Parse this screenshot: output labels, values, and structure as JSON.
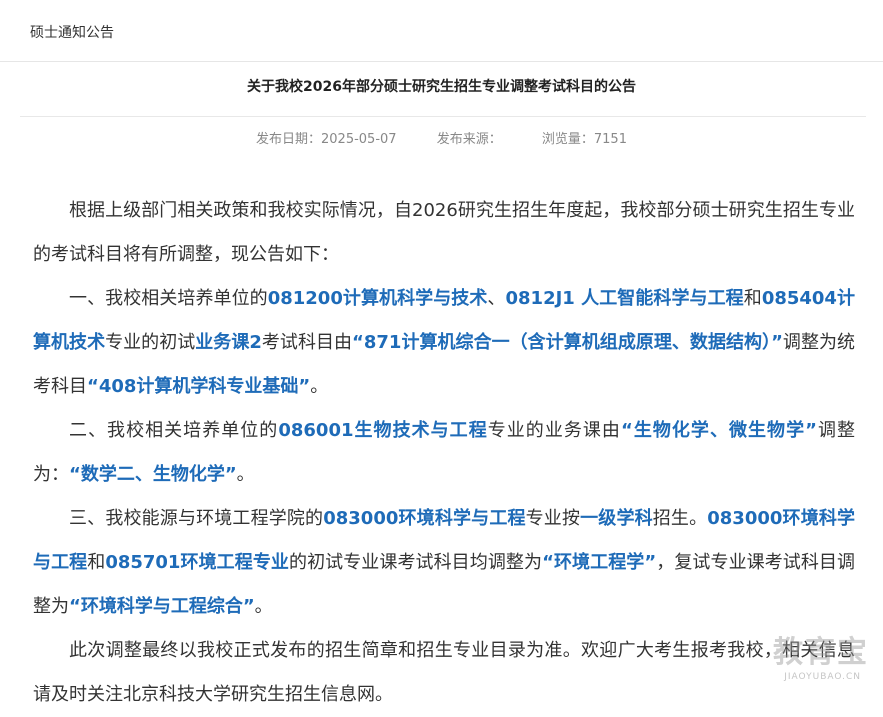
{
  "breadcrumb": "硕士通知公告",
  "article": {
    "title": "关于我校2026年部分硕士研究生招生专业调整考试科目的公告",
    "meta": {
      "date_label": "发布日期：",
      "date": "2025-05-07",
      "source_label": "发布来源：",
      "source": "",
      "views_label": "浏览量：",
      "views": "7151"
    },
    "paragraphs": [
      [
        {
          "text": "根据上级部门相关政策和我校实际情况，自2026研究生招生年度起，我校部分硕士研究生招生专业的考试科目将有所调整，现公告如下："
        }
      ],
      [
        {
          "text": "一、我校相关培养单位的"
        },
        {
          "text": "081200计算机科学与技术",
          "hl": true
        },
        {
          "text": "、"
        },
        {
          "text": "0812J1 人工智能科学与工程",
          "hl": true
        },
        {
          "text": "和"
        },
        {
          "text": "085404计算机技术",
          "hl": true
        },
        {
          "text": "专业的初试"
        },
        {
          "text": "业务课2",
          "hl": true
        },
        {
          "text": "考试科目由"
        },
        {
          "text": "“871计算机综合一（含计算机组成原理、数据结构）”",
          "hl": true
        },
        {
          "text": "调整为统考科目"
        },
        {
          "text": "“408计算机学科专业基础”",
          "hl": true
        },
        {
          "text": "。"
        }
      ],
      [
        {
          "text": "二、我校相关培养单位的"
        },
        {
          "text": "086001生物技术与工程",
          "hl": true
        },
        {
          "text": "专业的业务课由"
        },
        {
          "text": "“生物化学、微生物学”",
          "hl": true
        },
        {
          "text": "调整为："
        },
        {
          "text": "“数学二、生物化学”",
          "hl": true
        },
        {
          "text": "。"
        }
      ],
      [
        {
          "text": "三、我校能源与环境工程学院的"
        },
        {
          "text": "083000环境科学与工程",
          "hl": true
        },
        {
          "text": "专业按"
        },
        {
          "text": "一级学科",
          "hl": true
        },
        {
          "text": "招生。"
        },
        {
          "text": "083000环境科学与工程",
          "hl": true
        },
        {
          "text": "和"
        },
        {
          "text": "085701环境工程专业",
          "hl": true
        },
        {
          "text": "的初试专业课考试科目均调整为"
        },
        {
          "text": "“环境工程学”",
          "hl": true
        },
        {
          "text": "，复试专业课考试科目调整为"
        },
        {
          "text": "“环境科学与工程综合”",
          "hl": true
        },
        {
          "text": "。"
        }
      ],
      [
        {
          "text": "此次调整最终以我校正式发布的招生简章和招生专业目录为准。欢迎广大考生报考我校，相关信息请及时关注北京科技大学研究生招生信息网。"
        }
      ]
    ]
  },
  "watermark": {
    "main": "教育宝",
    "sub": "JIAOYUBAO.CN"
  }
}
